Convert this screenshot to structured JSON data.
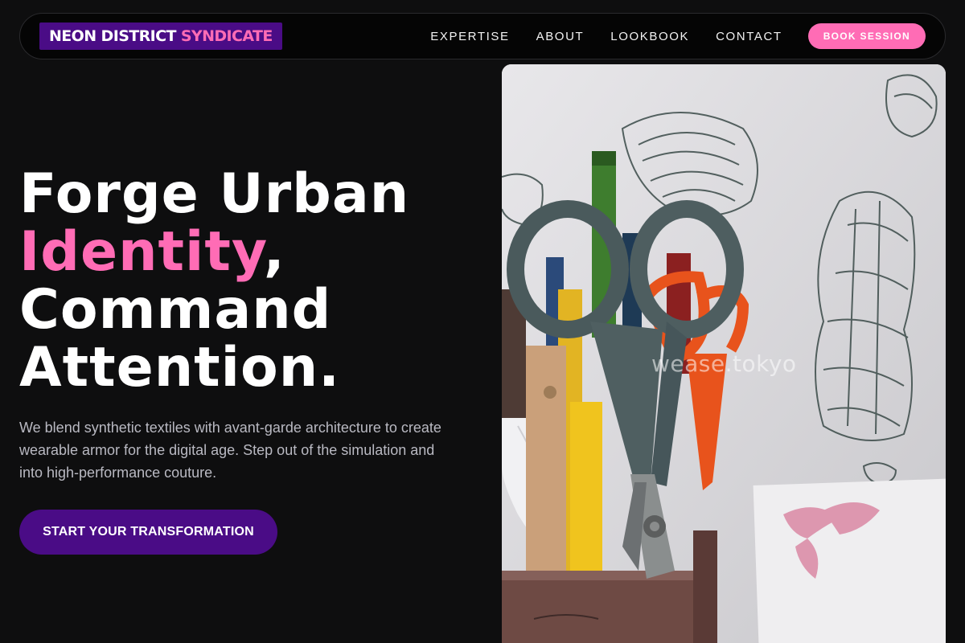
{
  "brand": {
    "part1": "NEON DISTRICT",
    "part2": "SYNDICATE"
  },
  "nav": {
    "links": [
      "EXPERTISE",
      "ABOUT",
      "LOOKBOOK",
      "CONTACT"
    ],
    "cta": "BOOK SESSION"
  },
  "hero": {
    "title_line1": "Forge Urban",
    "title_accent": "Identity",
    "title_comma": ",",
    "title_line3": "Command",
    "title_line4": "Attention.",
    "copy": "We blend synthetic textiles with avant-garde architecture to create wearable armor for the digital age. Step out of the simulation and into high-performance couture.",
    "cta": "START YOUR TRANSFORMATION"
  },
  "photo": {
    "watermark": "wease.tokyo"
  },
  "colors": {
    "accent_pink": "#ff6cb5",
    "brand_purple": "#4a0c86",
    "background": "#0e0e0f"
  }
}
